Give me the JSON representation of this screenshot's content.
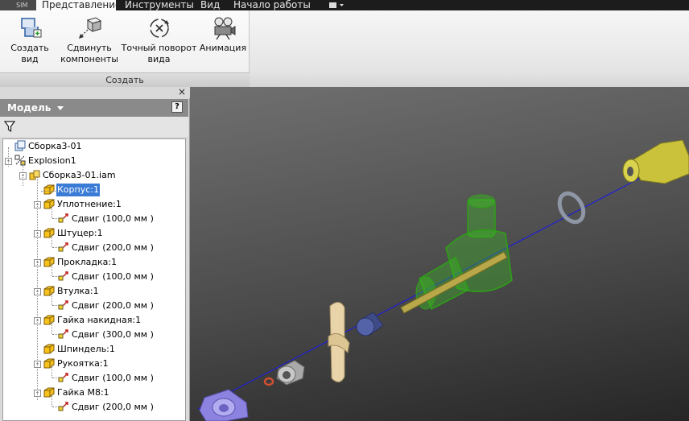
{
  "menu": {
    "app_badge": "SIM",
    "tabs": [
      "Представление",
      "Инструменты",
      "Вид",
      "Начало работы"
    ]
  },
  "ribbon": {
    "buttons": [
      {
        "label": "Создать вид",
        "icon": "create-view-icon"
      },
      {
        "label": "Сдвинуть компоненты",
        "icon": "tweak-components-icon"
      },
      {
        "label": "Точный поворот вида",
        "icon": "precise-rotate-icon"
      },
      {
        "label": "Анимация",
        "icon": "animation-icon"
      }
    ],
    "panel_title": "Создать"
  },
  "browser": {
    "close_glyph": "×",
    "title": "Модель",
    "help": "?",
    "tree": [
      {
        "label": "Сборка3-01",
        "icon": "presentation-icon"
      },
      {
        "label": "Explosion1",
        "icon": "explosion-icon"
      },
      {
        "label": "Сборка3-01.iam",
        "icon": "assembly-icon"
      },
      {
        "label": "Корпус:1",
        "icon": "part-icon",
        "selected": true
      },
      {
        "label": "Уплотнение:1",
        "icon": "part-icon"
      },
      {
        "label": "Сдвиг (100,0 мм )",
        "icon": "tweak-icon"
      },
      {
        "label": "Штуцер:1",
        "icon": "part-icon"
      },
      {
        "label": "Сдвиг (200,0 мм )",
        "icon": "tweak-icon"
      },
      {
        "label": "Прокладка:1",
        "icon": "part-icon"
      },
      {
        "label": "Сдвиг (100,0 мм )",
        "icon": "tweak-icon"
      },
      {
        "label": "Втулка:1",
        "icon": "part-icon"
      },
      {
        "label": "Сдвиг (200,0 мм )",
        "icon": "tweak-icon"
      },
      {
        "label": "Гайка накидная:1",
        "icon": "part-icon"
      },
      {
        "label": "Сдвиг (300,0 мм )",
        "icon": "tweak-icon"
      },
      {
        "label": "Шпиндель:1",
        "icon": "part-icon"
      },
      {
        "label": "Рукоятка:1",
        "icon": "part-icon"
      },
      {
        "label": "Сдвиг (100,0 мм )",
        "icon": "tweak-icon"
      },
      {
        "label": "Гайка М8:1",
        "icon": "part-icon"
      },
      {
        "label": "Сдвиг (200,0 мм )",
        "icon": "tweak-icon"
      }
    ]
  },
  "colors": {
    "selection": "#3a7bd5",
    "axis_line": "#1f1fd6",
    "housing_green": "#39c21f",
    "fitting_yellow": "#c9c23a"
  }
}
